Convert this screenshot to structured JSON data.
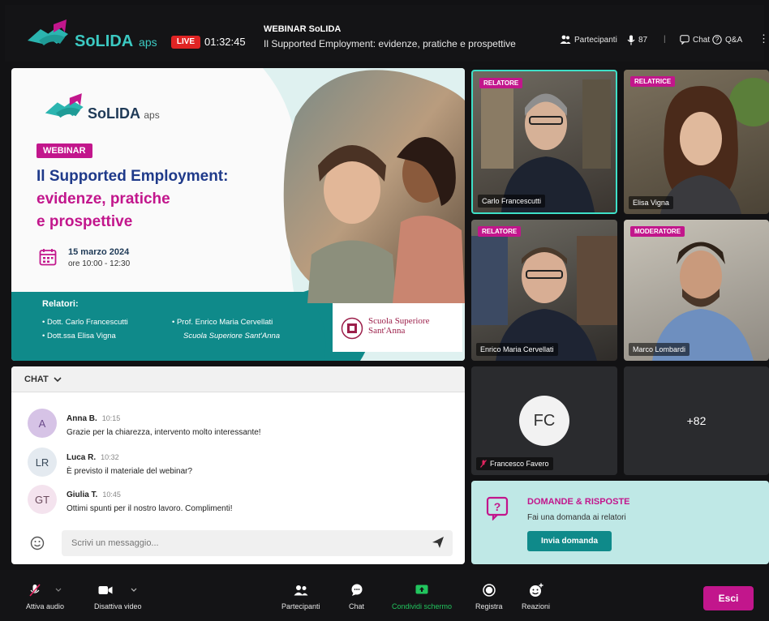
{
  "brand": {
    "name": "SoLIDA",
    "suffix": "aps"
  },
  "header": {
    "live_label": "LIVE",
    "timer": "01:32:45",
    "kicker": "WEBINAR SoLIDA",
    "title": "Il Supported Employment: evidenze, pratiche e prospettive",
    "participants_label": "Partecipanti",
    "mic_count": "87",
    "chat_label": "Chat",
    "qa_label": "Q&A",
    "separator": "|"
  },
  "banner": {
    "badge": "WEBINAR",
    "title_lines": [
      "Il Supported Employment:",
      "evidenze, pratiche",
      "e prospettive"
    ],
    "date": "15 marzo 2024",
    "time": "ore 10:00 - 12:30",
    "speakers_heading": "Relatori:",
    "speakers_left": [
      "Dott. Carlo Francescutti",
      "Dott.ssa Elisa Vigna"
    ],
    "speakers_right": [
      "Prof. Enrico Maria Cervellati",
      "Scuola Superiore Sant'Anna"
    ],
    "institution_lines": [
      "Scuola Superiore",
      "Sant'Anna"
    ]
  },
  "videos": [
    {
      "role": "RELATORE",
      "name": "Carlo Francescutti"
    },
    {
      "role": "RELATRICE",
      "name": "Elisa Vigna"
    },
    {
      "role": "RELATORE",
      "name": "Enrico Maria Cervellati"
    },
    {
      "role": "MODERATORE",
      "name": "Marco Lombardi"
    }
  ],
  "muted_participant": {
    "initials": "FC",
    "name": "Francesco Favero"
  },
  "more_count": "+82",
  "chat": {
    "header": "CHAT",
    "messages": [
      {
        "initials": "A",
        "author": "Anna B.",
        "time": "10:15",
        "text": "Grazie per la chiarezza, intervento molto interessante!"
      },
      {
        "initials": "LR",
        "author": "Luca R.",
        "time": "10:32",
        "text": "È previsto il materiale del webinar?"
      },
      {
        "initials": "GT",
        "author": "Giulia T.",
        "time": "10:45",
        "text": "Ottimi spunti per il nostro lavoro. Complimenti!"
      }
    ],
    "input_placeholder": "Scrivi un messaggio..."
  },
  "qa": {
    "title": "DOMANDE & RISPOSTE",
    "subtitle": "Fai una domanda ai relatori",
    "button": "Invia domanda",
    "icon_glyph": "?"
  },
  "toolbar": {
    "audio": "Attiva audio",
    "video": "Disattiva video",
    "participants": "Partecipanti",
    "chat": "Chat",
    "share": "Condividi schermo",
    "record": "Registra",
    "reactions": "Reazioni",
    "exit": "Esci"
  },
  "colors": {
    "accent": "#c2168c",
    "teal": "#0f8a8a",
    "live": "#e02424",
    "share_active": "#22c55e",
    "qa_bg": "#bfe8e6"
  }
}
